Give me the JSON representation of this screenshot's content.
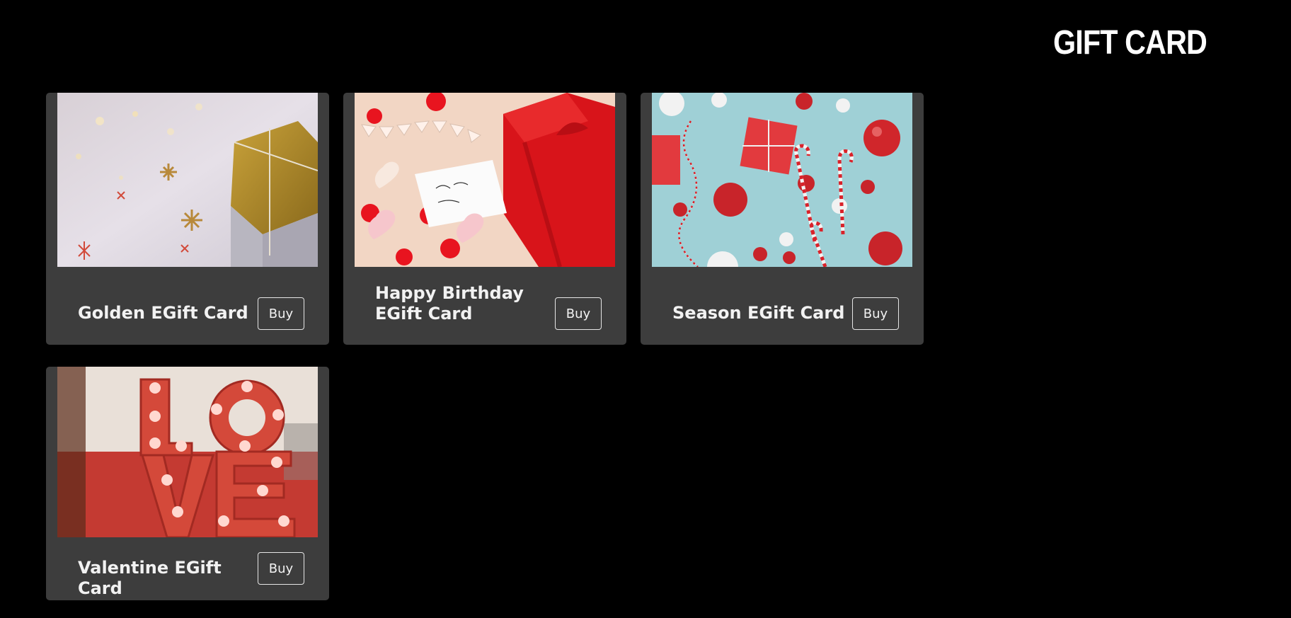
{
  "header": {
    "title": "GIFT CARD"
  },
  "cards": [
    {
      "title": "Golden EGift Card",
      "button_label": "Buy",
      "image": "golden-gift-box-photo"
    },
    {
      "title": "Happy Birthday EGift Card",
      "button_label": "Buy",
      "image": "red-gift-box-hearts-photo"
    },
    {
      "title": "Season EGift Card",
      "button_label": "Buy",
      "image": "christmas-ornaments-photo"
    },
    {
      "title": "Valentine EGift Card",
      "button_label": "Buy",
      "image": "love-marquee-letters-photo"
    }
  ],
  "colors": {
    "background": "#000000",
    "card_background": "#3d3d3d",
    "text": "#f2f2f2"
  }
}
